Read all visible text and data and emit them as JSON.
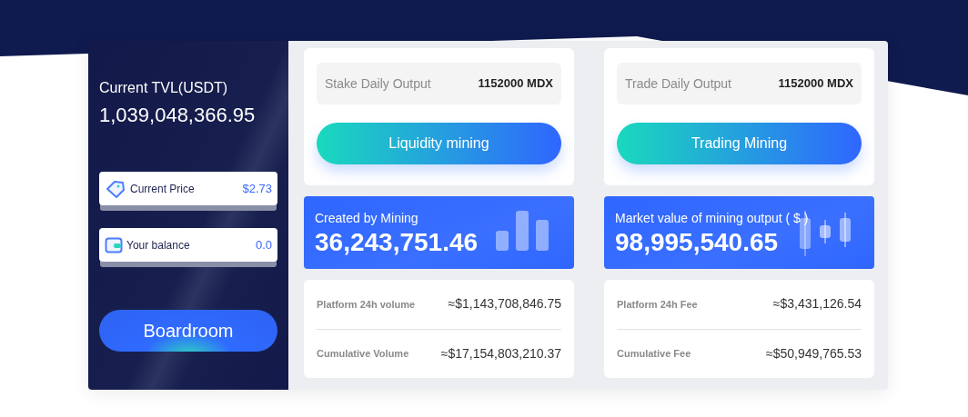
{
  "tvl": {
    "label": "Current TVL(USDT)",
    "value": "1,039,048,366.95"
  },
  "stats": [
    {
      "kind": "price",
      "label": "Current Price",
      "value": "$2.73"
    },
    {
      "kind": "balance",
      "label": "Your balance",
      "value": "0.0"
    }
  ],
  "boardroom_button": "Boardroom",
  "columns": [
    {
      "output_label": "Stake Daily Output",
      "output_value": "1152000 MDX",
      "button": "Liquidity mining",
      "mining_label": "Created by Mining",
      "mining_value": "36,243,751.46",
      "kind": "bars",
      "rows": [
        {
          "label": "Platform 24h volume",
          "value": "≈$1,143,708,846.75"
        },
        {
          "label": "Cumulative Volume",
          "value": "≈$17,154,803,210.37"
        }
      ]
    },
    {
      "output_label": "Trade Daily Output",
      "output_value": "1152000 MDX",
      "button": "Trading Mining",
      "mining_label": "Market value of mining output ( $ )",
      "mining_value": "98,995,540.65",
      "kind": "candles",
      "rows": [
        {
          "label": "Platform 24h Fee",
          "value": "≈$3,431,126.54"
        },
        {
          "label": "Cumulative Fee",
          "value": "≈$50,949,765.53"
        }
      ]
    }
  ]
}
